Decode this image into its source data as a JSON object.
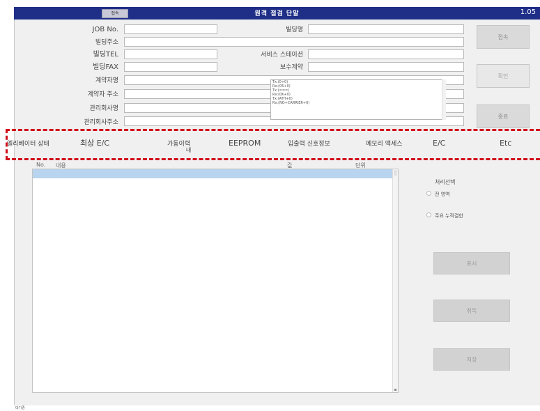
{
  "window": {
    "title": "원격 점검 단말",
    "version": "1.05",
    "title_button": "접속"
  },
  "form": {
    "labels": {
      "job_no": "JOB No.",
      "site_address": "빌딩주소",
      "site_tel": "빌딩TEL",
      "site_fax": "빌딩FAX",
      "contractor": "계약자명",
      "contractor_address": "계약자 주소",
      "management_company": "관리회사명",
      "management_address": "관리회사주소",
      "building_name": "빌딩명",
      "service_station": "서비스 스테이션",
      "maintenance_contract": "보수계약"
    },
    "values": {
      "job_no": "",
      "site_address": "",
      "site_tel": "",
      "site_fax": "",
      "contractor": "",
      "contractor_address": "",
      "management_company": "",
      "management_address": "",
      "building_name": "",
      "service_station": "",
      "maintenance_contract": ""
    },
    "port_list": [
      "Tx:(0+0)",
      "Rx:(05+0)",
      "Tx:(===)",
      "Rx:(0K+0)",
      "Tx:(ATH+0)",
      "Rx:(NO+CARRIER+0)"
    ]
  },
  "buttons": {
    "connect": "접속",
    "confirm": "확인",
    "end": "종료",
    "display": "표시",
    "cancel": "취득",
    "save": "저장"
  },
  "tabs": [
    "엘리베이터 상태",
    "최상 E/C",
    "가동이력",
    "EEPROM",
    "입출력 신호정보",
    "메모리 액세스",
    "E/C",
    "Etc"
  ],
  "tab_sub": "내",
  "list": {
    "col_no": "No.",
    "col_content": "내용",
    "col_value": "값",
    "col_unit": "단위"
  },
  "process": {
    "heading": "처리선택",
    "option1": "전 영역",
    "option2": "주요 누적결한"
  },
  "status_bar": "대기중",
  "colors": {
    "title_bar": "#1f2f88",
    "highlight_dash": "#d10f1a",
    "selected_row": "#b8d4ee"
  }
}
